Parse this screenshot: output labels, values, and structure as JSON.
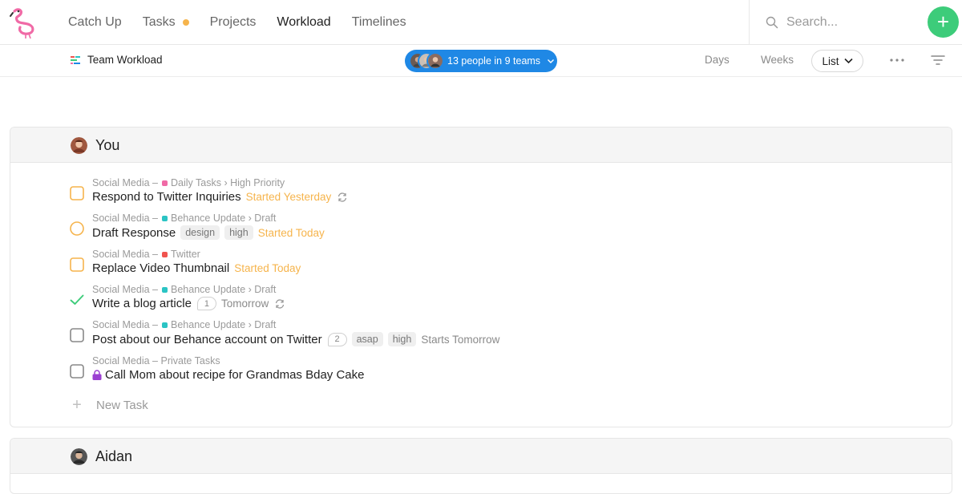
{
  "nav": {
    "items": [
      {
        "label": "Catch Up",
        "active": false,
        "dot": false
      },
      {
        "label": "Tasks",
        "active": false,
        "dot": true
      },
      {
        "label": "Projects",
        "active": false,
        "dot": false
      },
      {
        "label": "Workload",
        "active": true,
        "dot": false
      },
      {
        "label": "Timelines",
        "active": false,
        "dot": false
      }
    ],
    "search_placeholder": "Search...",
    "add_icon": "plus-icon"
  },
  "subbar": {
    "title": "Team Workload",
    "people_label": "13 people in 9 teams",
    "view_days": "Days",
    "view_weeks": "Weeks",
    "view_list": "List"
  },
  "colors": {
    "accent_blue": "#1f88e5",
    "accent_green": "#3dcc7a",
    "orange": "#f6b44c",
    "pink": "#f06aa6",
    "teal": "#2bc4c4",
    "red": "#f0544f",
    "purple": "#9b3fd1"
  },
  "sections": [
    {
      "name": "You",
      "tasks": [
        {
          "project": "Social Media",
          "list": "Daily Tasks",
          "list_color": "#f06aa6",
          "sub": "High Priority",
          "title": "Respond to Twitter Inquiries",
          "status": "Started Yesterday",
          "check": "square-orange",
          "repeat": true
        },
        {
          "project": "Social Media",
          "list": "Behance Update",
          "list_color": "#2bc4c4",
          "sub": "Draft",
          "title": "Draft Response",
          "tags": [
            "design",
            "high"
          ],
          "status": "Started Today",
          "check": "circle-orange"
        },
        {
          "project": "Social Media",
          "list": "Twitter",
          "list_color": "#f0544f",
          "sub": "",
          "title": "Replace Video Thumbnail",
          "status": "Started Today",
          "check": "square-orange"
        },
        {
          "project": "Social Media",
          "list": "Behance Update",
          "list_color": "#2bc4c4",
          "sub": "Draft",
          "title": "Write a blog article",
          "comments": "1",
          "status": "Tomorrow",
          "check": "done",
          "repeat": true
        },
        {
          "project": "Social Media",
          "list": "Behance Update",
          "list_color": "#2bc4c4",
          "sub": "Draft",
          "title": "Post about our Behance account on Twitter",
          "comments": "2",
          "tags": [
            "asap",
            "high"
          ],
          "status": "Starts Tomorrow",
          "check": "square-gray"
        },
        {
          "project": "Social Media",
          "list": "Private Tasks",
          "list_color": "",
          "sub": "",
          "title": "Call Mom about recipe for Grandmas Bday Cake",
          "check": "square-gray",
          "locked": true
        }
      ],
      "new_task_label": "New Task"
    },
    {
      "name": "Aidan"
    }
  ]
}
